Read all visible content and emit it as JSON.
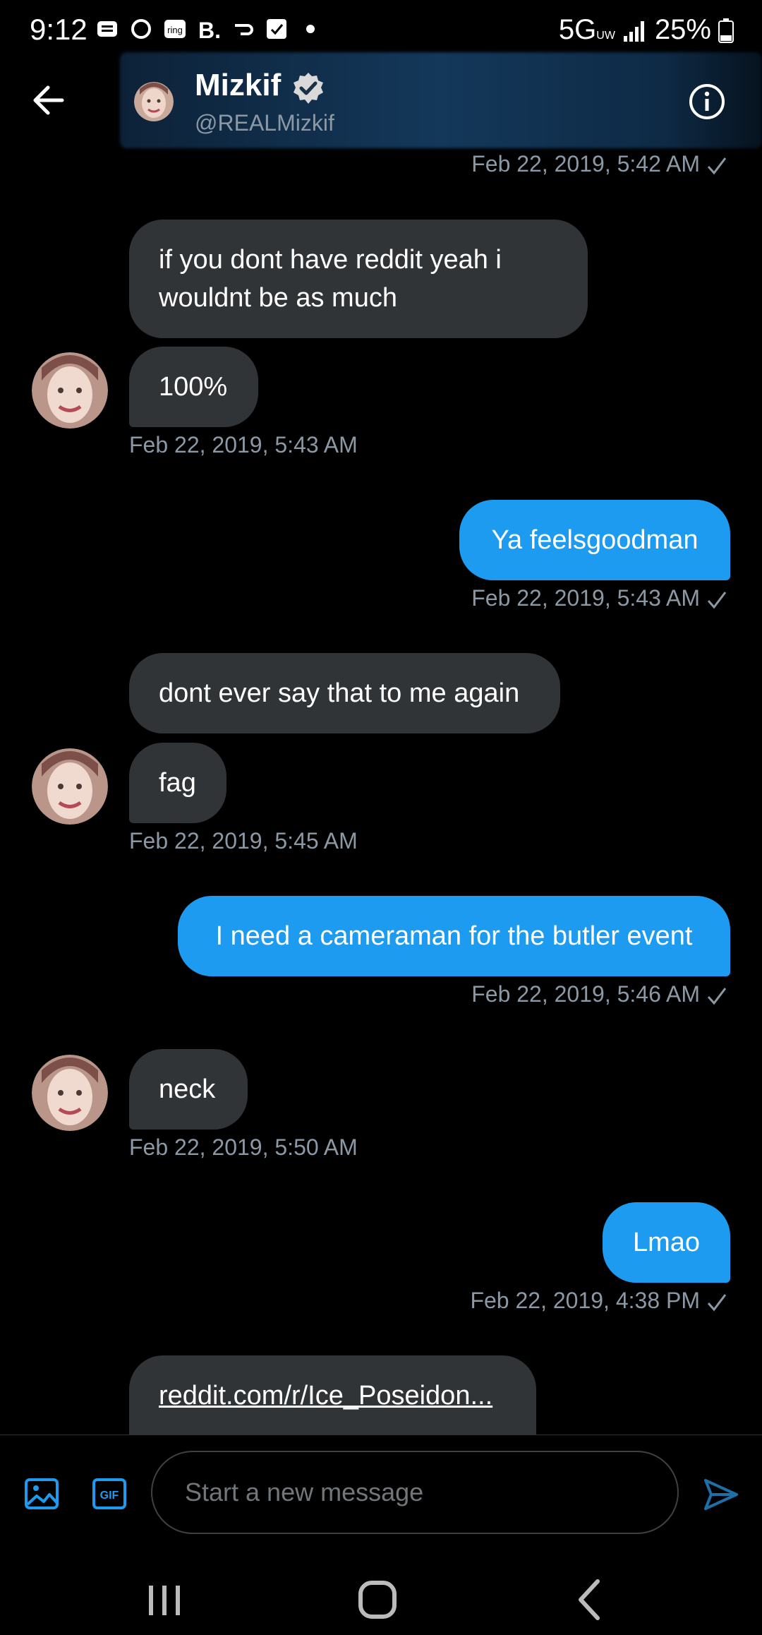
{
  "status_bar": {
    "time": "9:12",
    "signal": "5G",
    "signal_sub": "UW",
    "battery": "25%"
  },
  "header": {
    "name": "Mizkif",
    "handle": "@REALMizkif"
  },
  "messages": {
    "m0_time": "Feb 22, 2019, 5:42 AM",
    "m1": "if you dont have reddit yeah i wouldnt be as much",
    "m2": "100%",
    "m2_time": "Feb 22, 2019, 5:43 AM",
    "m3": "Ya feelsgoodman",
    "m3_time": "Feb 22, 2019, 5:43 AM",
    "m4": "dont ever say that to me again",
    "m5": "fag",
    "m5_time": "Feb 22, 2019, 5:45 AM",
    "m6": "I need a cameraman for the butler event",
    "m6_time": "Feb 22, 2019, 5:46 AM",
    "m7": "neck",
    "m7_time": "Feb 22, 2019, 5:50 AM",
    "m8": "Lmao",
    "m8_time": "Feb 22, 2019, 4:38 PM",
    "m9": "reddit.com/r/Ice_Poseidon..."
  },
  "composer": {
    "placeholder": "Start a new message"
  },
  "colors": {
    "accent": "#1d9bf0",
    "received_bubble": "#313437",
    "meta": "#8b98a5"
  }
}
